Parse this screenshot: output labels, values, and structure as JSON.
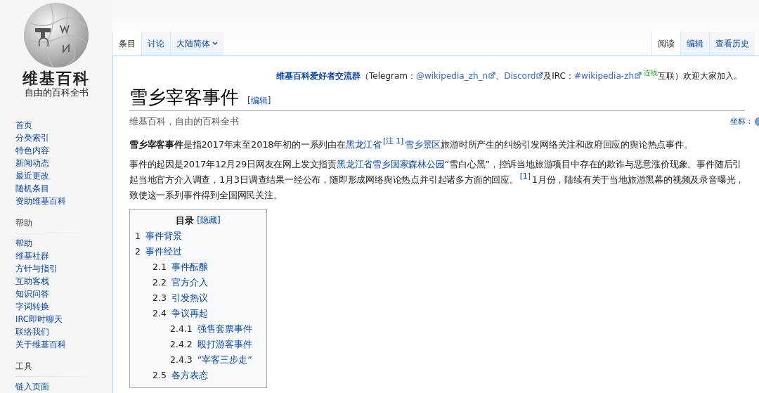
{
  "logo": {
    "name": "维基百科",
    "tagline": "自由的百科全书"
  },
  "sidebar": {
    "nav": [
      "首页",
      "分类索引",
      "特色内容",
      "新闻动态",
      "最近更改",
      "随机条目",
      "资助维基百科"
    ],
    "sections": [
      {
        "heading": "帮助",
        "items": [
          "帮助",
          "维基社群",
          "方针与指引",
          "互助客栈",
          "知识问答",
          "字词转换",
          "IRC即时聊天",
          "联络我们",
          "关于维基百科"
        ]
      },
      {
        "heading": "工具",
        "items": [
          "链入页面"
        ]
      }
    ]
  },
  "tabs_left": [
    {
      "label": "条目",
      "selected": true,
      "kind": "tab"
    },
    {
      "label": "讨论",
      "selected": false,
      "kind": "tab"
    },
    {
      "label": "大陆简体",
      "selected": false,
      "kind": "dropdown"
    }
  ],
  "tabs_right": [
    {
      "label": "阅读",
      "selected": true
    },
    {
      "label": "编辑",
      "selected": false
    },
    {
      "label": "查看历史",
      "selected": false
    }
  ],
  "notice": [
    {
      "kind": "bold-link",
      "text": "维基百科爱好者交流群"
    },
    {
      "kind": "text",
      "text": "（Telegram："
    },
    {
      "kind": "ext-link",
      "text": "@wikipedia_zh_n"
    },
    {
      "kind": "text",
      "text": "、"
    },
    {
      "kind": "ext-link",
      "text": "Discord"
    },
    {
      "kind": "text",
      "text": "及IRC："
    },
    {
      "kind": "ext-link",
      "text": "#wikipedia-zh"
    },
    {
      "kind": "green-sup",
      "text": "连线"
    },
    {
      "kind": "text",
      "text": "互联）欢迎大家加入。"
    }
  ],
  "title": "雪乡宰客事件",
  "edit_link": "[编辑]",
  "subtitle": "维基百科，自由的百科全书",
  "coordinates": "坐标：",
  "paragraphs": [
    [
      {
        "kind": "bold",
        "text": "雪乡宰客事件"
      },
      {
        "kind": "text",
        "text": "是指2017年末至2018年初的一系列由在"
      },
      {
        "kind": "link",
        "text": "黑龙江省"
      },
      {
        "kind": "sup-link",
        "text": "[注 1]"
      },
      {
        "kind": "link",
        "text": "雪乡景区"
      },
      {
        "kind": "text",
        "text": "旅游时所产生的纠纷引发网络关注和政府回应的舆论热点事件。"
      }
    ],
    [
      {
        "kind": "text",
        "text": "事件的起因是2017年12月29日网友在网上发文指责"
      },
      {
        "kind": "link",
        "text": "黑龙江省雪乡国家森林公园"
      },
      {
        "kind": "text",
        "text": "“雪白心黑”，控诉当地旅游项目中存在的欺诈与恶意涨价现象。事件随后引起当地官方介入调查，1月3日调查结果一经公布，随即形成网络舆论热点并引起诸多方面的回应。"
      },
      {
        "kind": "sup-link",
        "text": "[1]"
      },
      {
        "kind": "text",
        "text": "1月份，陆续有关于当地旅游黑幕的视频及录音曝光，致使这一系列事件得到全国网民关注。"
      }
    ]
  ],
  "toc": {
    "title": "目录",
    "toggle": "[隐藏]",
    "items": [
      {
        "number": "1",
        "title": "事件背景"
      },
      {
        "number": "2",
        "title": "事件经过",
        "children": [
          {
            "number": "2.1",
            "title": "事件酝酿"
          },
          {
            "number": "2.2",
            "title": "官方介入"
          },
          {
            "number": "2.3",
            "title": "引发热议"
          },
          {
            "number": "2.4",
            "title": "争议再起",
            "children": [
              {
                "number": "2.4.1",
                "title": "强售套票事件"
              },
              {
                "number": "2.4.2",
                "title": "殴打游客事件"
              },
              {
                "number": "2.4.3",
                "title": "“宰客三步走”"
              }
            ]
          },
          {
            "number": "2.5",
            "title": "各方表态"
          }
        ]
      }
    ]
  }
}
